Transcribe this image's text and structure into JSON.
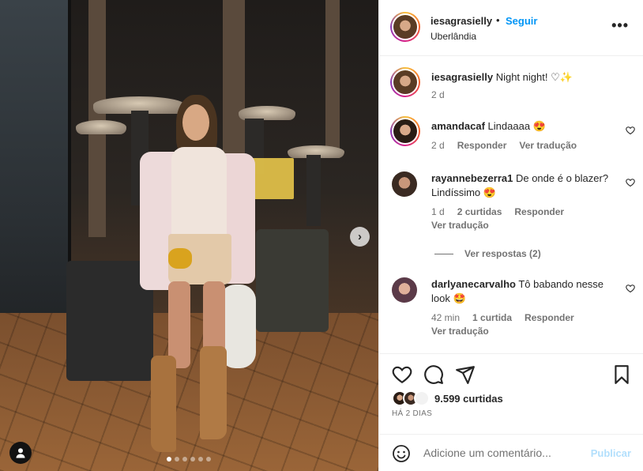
{
  "post": {
    "username": "iesagrasielly",
    "follow_label": "Seguir",
    "separator": "•",
    "location": "Uberlândia",
    "more_label": "•••",
    "caption": {
      "username": "iesagrasielly",
      "text": "Night night!",
      "emojis": "♡✨",
      "age": "2 d"
    }
  },
  "carousel": {
    "next_label": "›",
    "slide_count": 6,
    "active_slide": 1
  },
  "comments": [
    {
      "username": "amandacaf",
      "text": "Lindaaaa",
      "emoji": "😍",
      "age": "2 d",
      "reply_label": "Responder",
      "translate_label": "Ver tradução"
    },
    {
      "username": "rayannebezerra1",
      "text": "De onde é o blazer? Lindíssimo",
      "emoji": "😍",
      "age": "1 d",
      "likes": "2 curtidas",
      "reply_label": "Responder",
      "translate_label": "Ver tradução",
      "view_replies": "Ver respostas (2)"
    },
    {
      "username": "darlyanecarvalho",
      "text": "Tô babando nesse look",
      "emoji": "🤩",
      "age": "42 min",
      "likes": "1 curtida",
      "reply_label": "Responder",
      "translate_label": "Ver tradução"
    }
  ],
  "actions": {
    "likes": "9.599 curtidas",
    "time": "HÁ 2 DIAS"
  },
  "composer": {
    "placeholder": "Adicione um comentário...",
    "post_label": "Publicar"
  }
}
